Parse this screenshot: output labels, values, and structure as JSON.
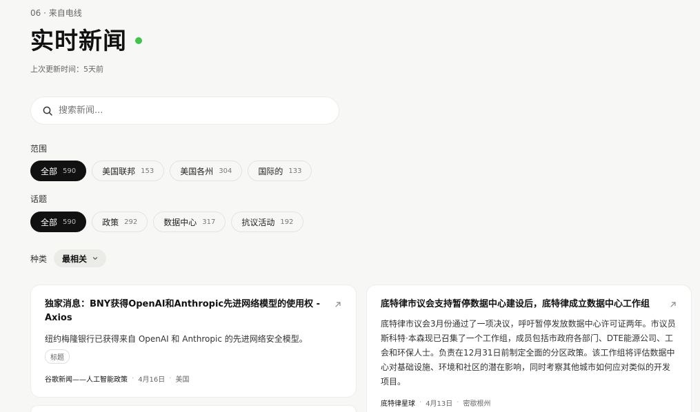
{
  "header": {
    "eyebrow": "06 · 来自电线",
    "title": "实时新闻",
    "updated": "上次更新时间：5天前"
  },
  "search": {
    "placeholder": "搜索新闻...",
    "value": ""
  },
  "scope": {
    "label": "范围",
    "chips": [
      {
        "label": "全部",
        "count": "590",
        "active": true
      },
      {
        "label": "美国联邦",
        "count": "153"
      },
      {
        "label": "美国各州",
        "count": "304"
      },
      {
        "label": "国际的",
        "count": "133"
      }
    ]
  },
  "topic": {
    "label": "话题",
    "chips": [
      {
        "label": "全部",
        "count": "590",
        "active": true
      },
      {
        "label": "政策",
        "count": "292"
      },
      {
        "label": "数据中心",
        "count": "317"
      },
      {
        "label": "抗议活动",
        "count": "192"
      }
    ]
  },
  "sort": {
    "label": "种类",
    "value": "最相关"
  },
  "cards": [
    {
      "title": "独家消息：BNY获得OpenAI和Anthropic先进网络模型的使用权 - Axios",
      "desc": "纽约梅隆银行已获得来自 OpenAI 和 Anthropic 的先进网络安全模型。",
      "tag": "标题",
      "source": "谷歌新闻——人工智能政策",
      "date": "4月16日",
      "region": "美国"
    },
    {
      "title": "底特律市议会支持暂停数据中心建设后，底特律成立数据中心工作组",
      "desc": "底特律市议会3月份通过了一项决议，呼吁暂停发放数据中心许可证两年。市议员斯科特·本森现已召集了一个工作组，成员包括市政府各部门、DTE能源公司、工会和环保人士。负责在12月31日前制定全面的分区政策。该工作组将评估数据中心对基础设施、环境和社区的潜在影响，同时考察其他城市如何应对类似的开发项目。",
      "source": "底特律星球",
      "date": "4月13日",
      "region": "密歇根州"
    }
  ],
  "colors": {
    "live": "#3ec54a",
    "active_chip": "#111111",
    "background": "#f7f7f5"
  }
}
